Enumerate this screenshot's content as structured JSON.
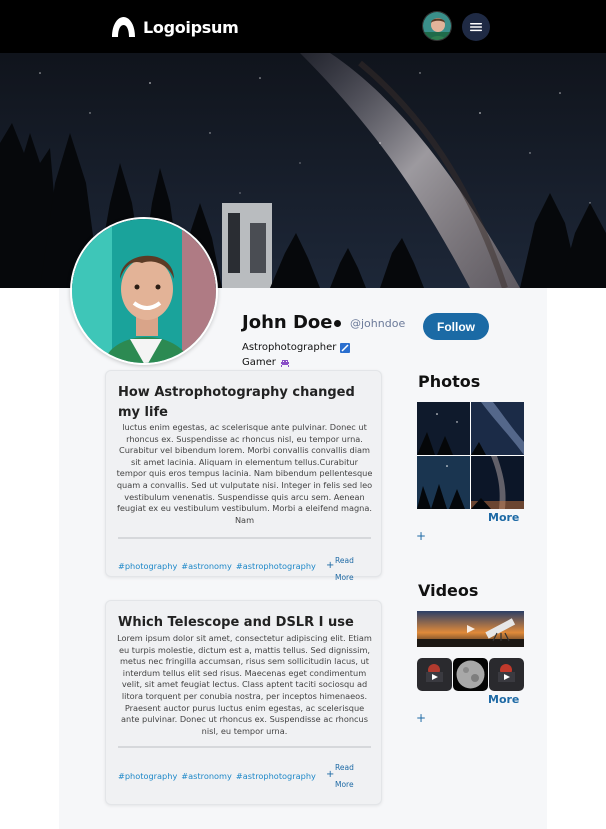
{
  "header": {
    "logo_text": "Logoipsum",
    "logo_icon": "logo-mark-icon",
    "menu_icon": "hamburger-icon",
    "background_color": "#000000"
  },
  "profile": {
    "name": "John Doe",
    "handle": "@johndoe",
    "follow_label": "Follow",
    "bio_line1": "Astrophotographer",
    "bio_line2": "Gamer",
    "bio_icon1": "telescope-badge-icon",
    "bio_icon2": "space-invader-icon"
  },
  "posts": [
    {
      "title": "How Astrophotography changed my life",
      "body": "luctus enim egestas, ac scelerisque ante pulvinar. Donec ut rhoncus ex. Suspendisse ac rhoncus nisl, eu tempor urna. Curabitur vel bibendum lorem. Morbi convallis convallis diam sit amet lacinia. Aliquam in elementum tellus.Curabitur tempor quis eros tempus lacinia. Nam bibendum pellentesque quam a convallis. Sed ut vulputate nisi. Integer in felis sed leo vestibulum venenatis. Suspendisse quis arcu sem. Aenean feugiat ex eu vestibulum vestibulum. Morbi a eleifend magna. Nam",
      "tags": [
        "#photography",
        "#astronomy",
        "#astrophotography"
      ],
      "plus": "+",
      "read_more": "Read More"
    },
    {
      "title": "Which Telescope and DSLR I use",
      "body": "Lorem ipsum dolor sit amet, consectetur adipiscing elit. Etiam eu turpis molestie, dictum est a, mattis tellus. Sed dignissim, metus nec fringilla accumsan, risus sem sollicitudin lacus, ut interdum tellus elit sed risus. Maecenas eget condimentum velit, sit amet feugiat lectus. Class aptent taciti sociosqu ad litora torquent per conubia nostra, per inceptos himenaeos. Praesent auctor purus luctus enim egestas, ac scelerisque ante pulvinar. Donec ut rhoncus ex. Suspendisse ac rhoncus nisl, eu tempor urna.",
      "tags": [
        "#photography",
        "#astronomy",
        "#astrophotography"
      ],
      "plus": "+",
      "read_more": "Read More"
    }
  ],
  "sidebar": {
    "photos_title": "Photos",
    "photos_more": "More",
    "photos_plus": "+",
    "videos_title": "Videos",
    "videos_more": "More",
    "videos_plus": "+"
  },
  "colors": {
    "accent": "#1b6aa5",
    "tag": "#1e88c8",
    "panel": "#f6f7f9"
  }
}
